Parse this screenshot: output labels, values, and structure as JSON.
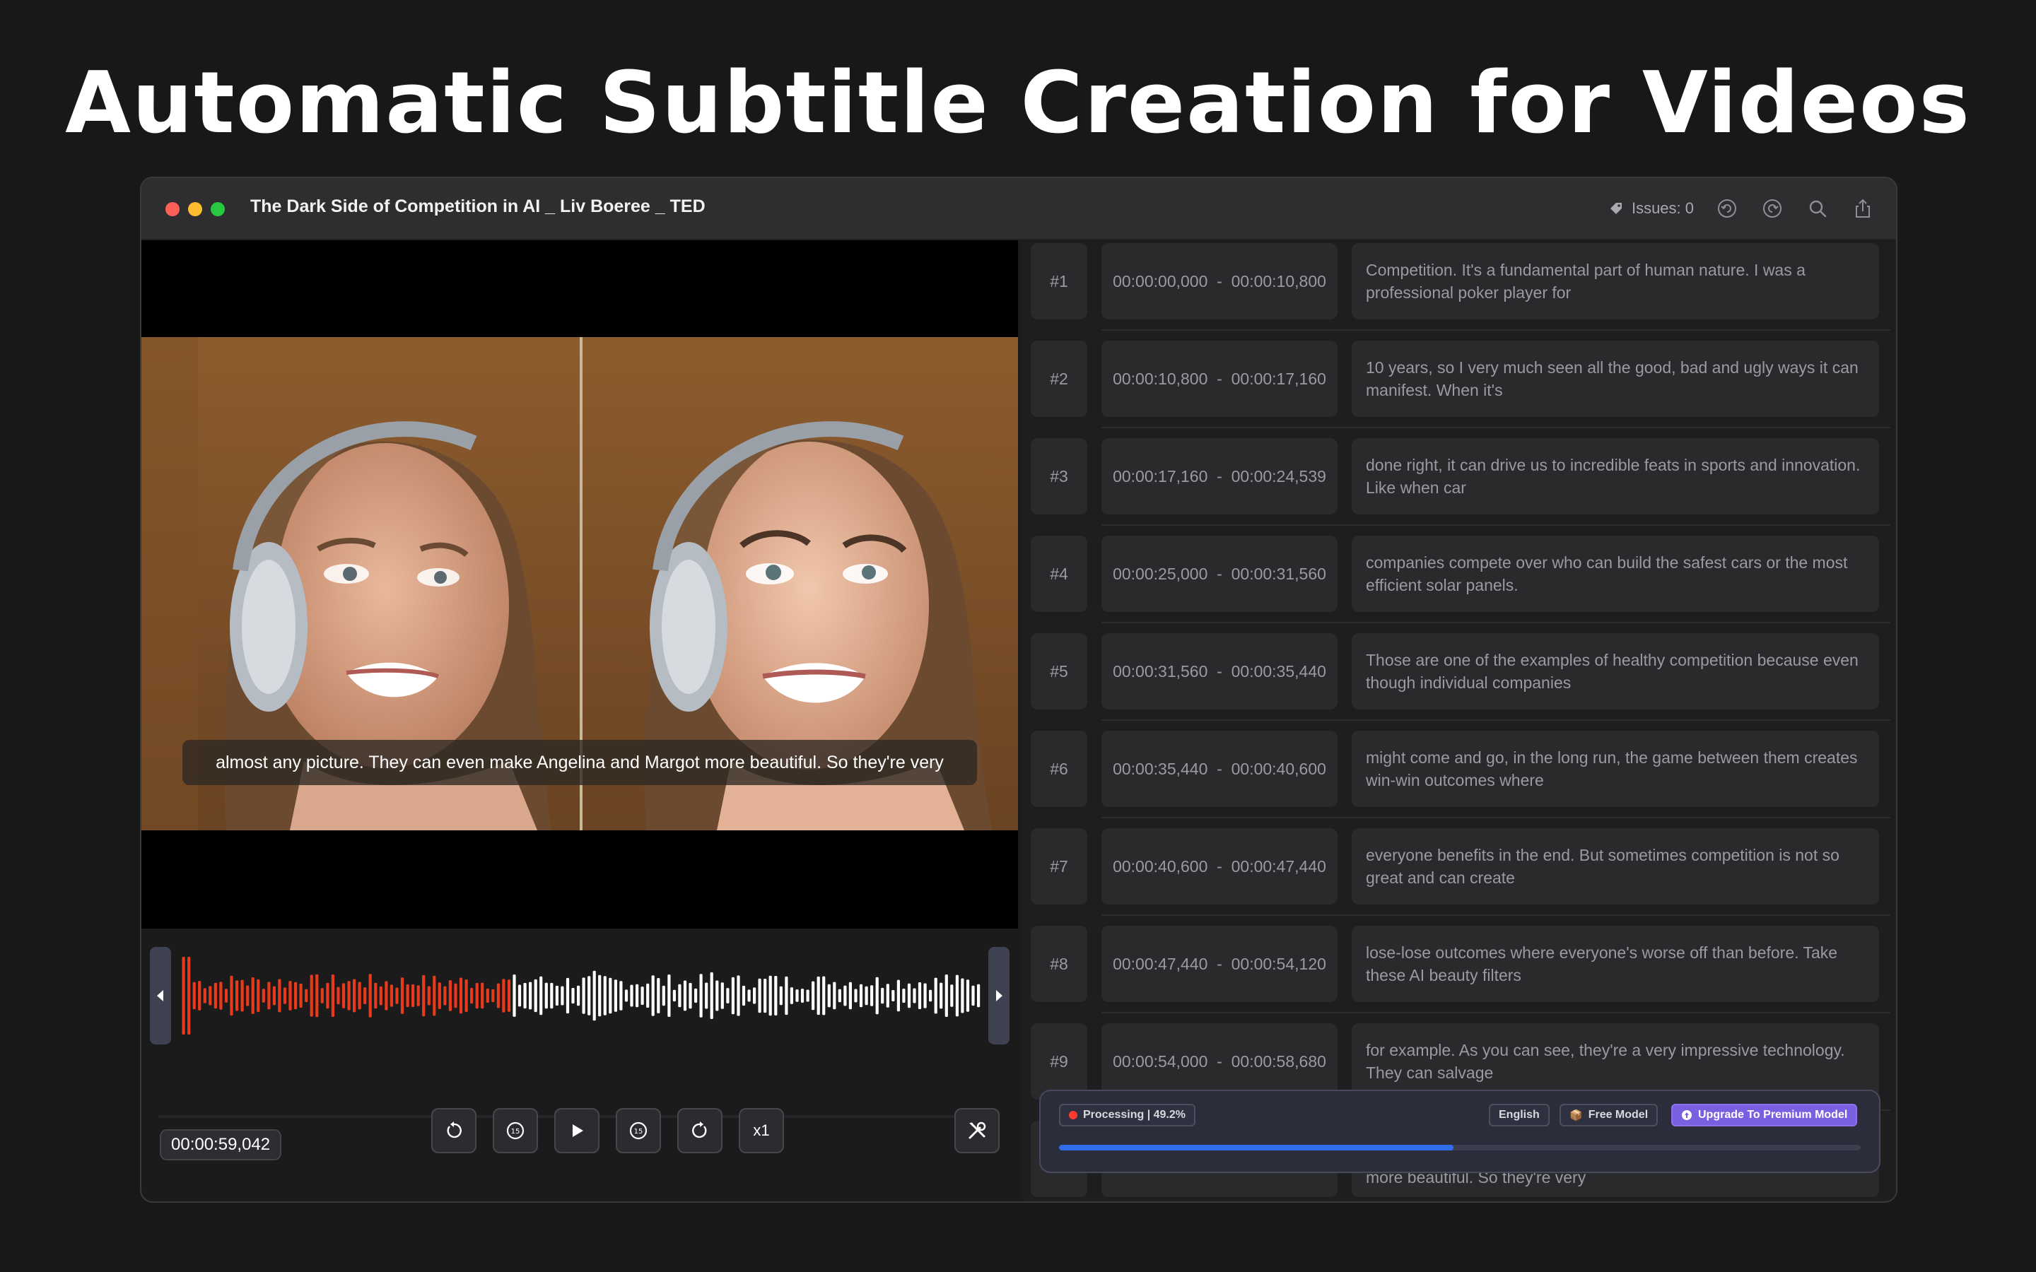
{
  "hero": {
    "title": "Automatic Subtitle Creation for Videos"
  },
  "window": {
    "title": "The Dark Side of Competition in AI _ Liv Boeree _ TED",
    "issues_label": "Issues: 0",
    "icons": [
      "tag-icon",
      "undo-icon",
      "redo-icon",
      "search-icon",
      "share-icon"
    ]
  },
  "player": {
    "subtitle": "almost any picture. They can even make Angelina and Margot more beautiful. So they're very",
    "current_time": "00:00:59,042",
    "speed_label": "x1",
    "skip_back_label": "15",
    "skip_forward_label": "15",
    "played_color": "#e83a1c",
    "unplayed_color": "#ffffff"
  },
  "subtitles": [
    {
      "num": "#1",
      "start": "00:00:00,000",
      "end": "00:00:10,800",
      "text": "Competition. It's a fundamental part of human nature. I was a professional poker player for"
    },
    {
      "num": "#2",
      "start": "00:00:10,800",
      "end": "00:00:17,160",
      "text": "10 years, so I very much seen all the good, bad and ugly ways it can manifest. When it's"
    },
    {
      "num": "#3",
      "start": "00:00:17,160",
      "end": "00:00:24,539",
      "text": "done right, it can drive us to incredible feats in sports and innovation. Like when car"
    },
    {
      "num": "#4",
      "start": "00:00:25,000",
      "end": "00:00:31,560",
      "text": "companies compete over who can build the safest cars or the most efficient solar panels."
    },
    {
      "num": "#5",
      "start": "00:00:31,560",
      "end": "00:00:35,440",
      "text": "Those are one of the examples of healthy competition because even though individual companies"
    },
    {
      "num": "#6",
      "start": "00:00:35,440",
      "end": "00:00:40,600",
      "text": "might come and go, in the long run, the game between them creates win-win outcomes where"
    },
    {
      "num": "#7",
      "start": "00:00:40,600",
      "end": "00:00:47,440",
      "text": "everyone benefits in the end. But sometimes competition is not so great and can create"
    },
    {
      "num": "#8",
      "start": "00:00:47,440",
      "end": "00:00:54,120",
      "text": "lose-lose outcomes where everyone's worse off than before. Take these AI beauty filters"
    },
    {
      "num": "#9",
      "start": "00:00:54,000",
      "end": "00:00:58,680",
      "text": "for example. As you can see, they're a very impressive technology. They can salvage"
    },
    {
      "num": "",
      "start": "",
      "end": "",
      "text": "more beautiful. So they're very"
    }
  ],
  "processing": {
    "status_label": "Processing | 49.2%",
    "progress": 0.492,
    "language": "English",
    "model": "Free Model",
    "upgrade_label": "Upgrade To Premium Model",
    "status_color": "#ff3b30",
    "accent_color": "#7a60e0"
  }
}
